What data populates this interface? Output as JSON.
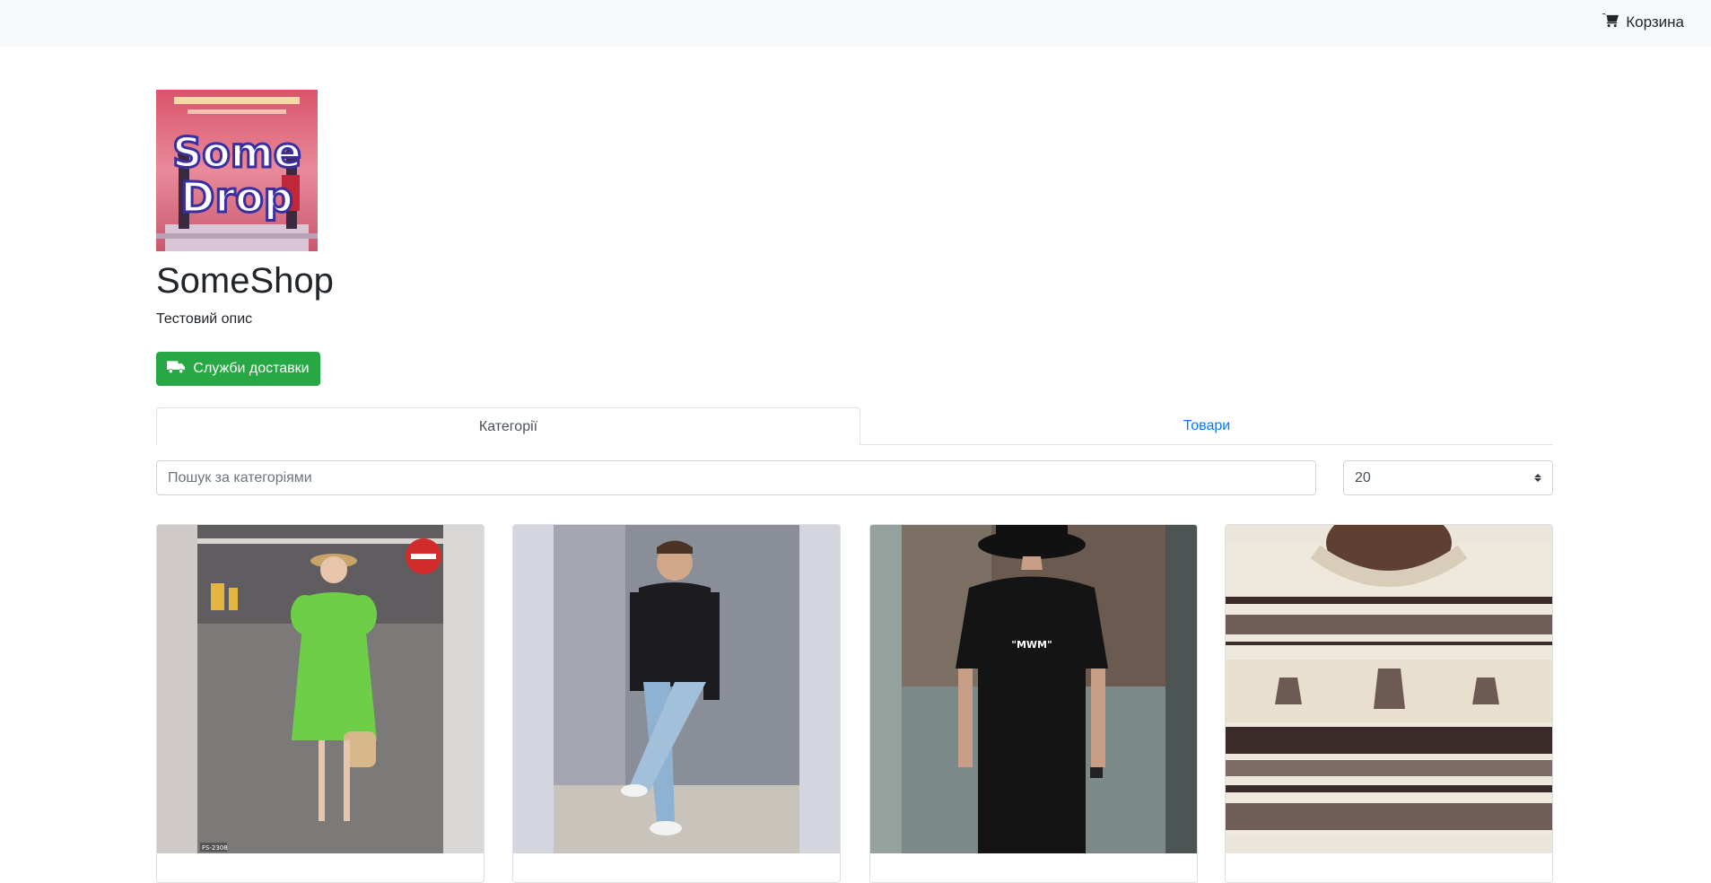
{
  "nav": {
    "cart_label": "Корзина",
    "cart_icon": "cart-icon"
  },
  "shop": {
    "logo_text_line1": "Some",
    "logo_text_line2": "Drop",
    "title": "SomeShop",
    "description": "Тестовий опис",
    "delivery_button_label": "Служби доставки",
    "delivery_icon": "truck-icon",
    "accent_color": "#28a745"
  },
  "tabs": [
    {
      "label": "Категорії",
      "active": true
    },
    {
      "label": "Товари",
      "active": false
    }
  ],
  "search": {
    "placeholder": "Пошук за категоріями",
    "value": ""
  },
  "per_page": {
    "selected": "20"
  },
  "cards": [
    {
      "image": "woman-green-dress-photo",
      "code": "FS-2308"
    },
    {
      "image": "man-black-turtleneck-photo"
    },
    {
      "image": "man-black-tshirt-bucket-hat-photo",
      "shirt_text": "\"MWM\""
    },
    {
      "image": "deer-pattern-sweater-photo"
    }
  ]
}
